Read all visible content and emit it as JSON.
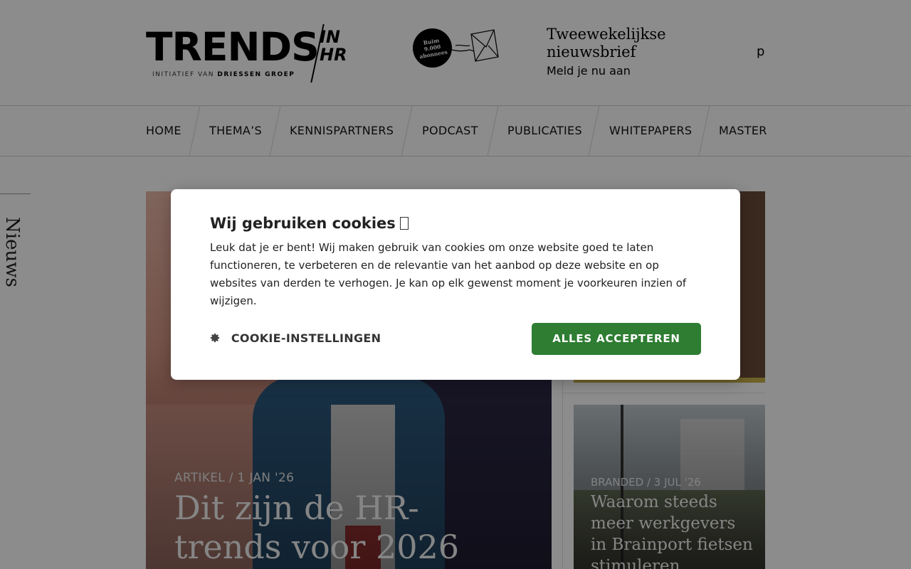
{
  "header": {
    "logo": {
      "main": "TRENDS",
      "suffix": "IN HR",
      "suffix_line1": "IN",
      "suffix_line2": "HR",
      "sub_prefix": "INITIATIEF VAN",
      "sub_brand": "DRIESSEN GROEP"
    },
    "badge": {
      "line1": "Ruim",
      "line2": "9.000",
      "line3": "abonnees"
    },
    "newsletter": {
      "title_line1": "Tweewekelijkse",
      "title_line2": "nieuwsbrief",
      "link": "Meld je nu aan"
    },
    "search_trigger": "p"
  },
  "nav": {
    "items": [
      "HOME",
      "THEMA’S",
      "KENNISPARTNERS",
      "PODCAST",
      "PUBLICATIES",
      "WHITEPAPERS",
      "MASTER"
    ]
  },
  "side_tab": {
    "label": "Nieuws"
  },
  "hero": {
    "type": "ARTIKEL",
    "sep": "/",
    "date": "1 JAN '26",
    "title": "Dit zijn de HR-trends voor 2026"
  },
  "cards": [
    {
      "type": "",
      "date": "",
      "title": ""
    },
    {
      "type": "BRANDED",
      "sep": "/",
      "date": "3 JUL '26",
      "title": "Waarom steeds meer werkgevers in Brainport fietsen stimuleren"
    }
  ],
  "cookie_dialog": {
    "title": "Wij gebruiken cookies",
    "body": "Leuk dat je er bent! Wij maken gebruik van cookies om onze website goed te laten functioneren, te verbeteren en de relevantie van het aanbod op deze website en op websites van derden te verhogen. Je kan op elk gewenst moment je voorkeuren inzien of wijzigen.",
    "settings_label": "COOKIE-INSTELLINGEN",
    "accept_label": "ALLES ACCEPTEREN",
    "accept_color": "#2e7d32"
  },
  "icons": {
    "settings": "gear-icon",
    "envelope": "envelope-icon"
  }
}
